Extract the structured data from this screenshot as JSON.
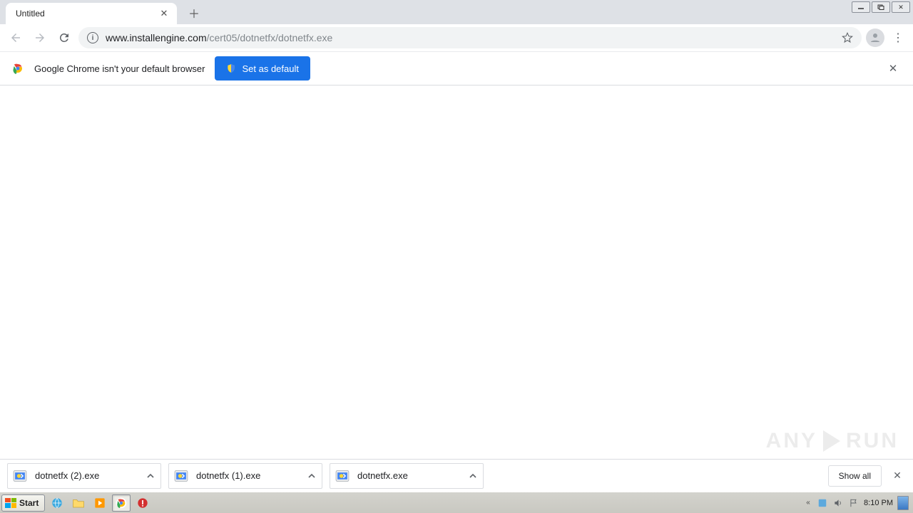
{
  "tab": {
    "title": "Untitled"
  },
  "url": {
    "host": "www.installengine.com",
    "path": "/cert05/dotnetfx/dotnetfx.exe"
  },
  "infobar": {
    "message": "Google Chrome isn't your default browser",
    "button": "Set as default"
  },
  "downloads": {
    "items": [
      {
        "name": "dotnetfx (2).exe"
      },
      {
        "name": "dotnetfx (1).exe"
      },
      {
        "name": "dotnetfx.exe"
      }
    ],
    "show_all": "Show all"
  },
  "taskbar": {
    "start": "Start",
    "clock": "8:10 PM"
  },
  "watermark": {
    "left": "ANY",
    "right": "RUN"
  }
}
